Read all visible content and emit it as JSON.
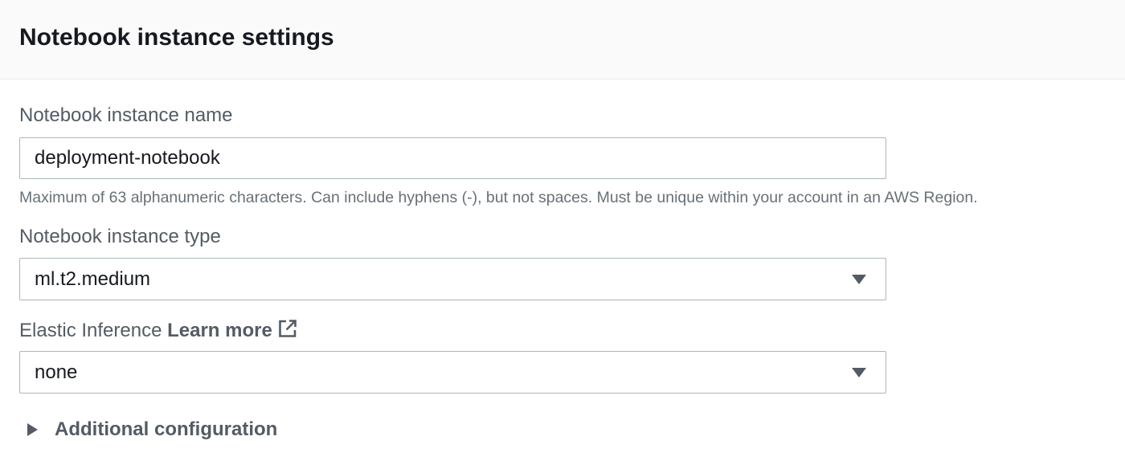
{
  "panel": {
    "title": "Notebook instance settings"
  },
  "instance_name": {
    "label": "Notebook instance name",
    "value": "deployment-notebook",
    "hint": "Maximum of 63 alphanumeric characters. Can include hyphens (-), but not spaces. Must be unique within your account in an AWS Region."
  },
  "instance_type": {
    "label": "Notebook instance type",
    "selected": "ml.t2.medium"
  },
  "elastic_inference": {
    "label": "Elastic Inference",
    "learn_more": "Learn more",
    "selected": "none"
  },
  "additional_config": {
    "label": "Additional configuration",
    "expanded": false
  },
  "icons": {
    "external_link": "external-link-icon",
    "dropdown_caret": "caret-down-icon",
    "expander_caret": "caret-right-icon"
  },
  "colors": {
    "header_bg": "#fafafa",
    "label_text": "#545b64",
    "body_text": "#16191f",
    "hint_text": "#687078",
    "input_border": "#aab7b8"
  }
}
